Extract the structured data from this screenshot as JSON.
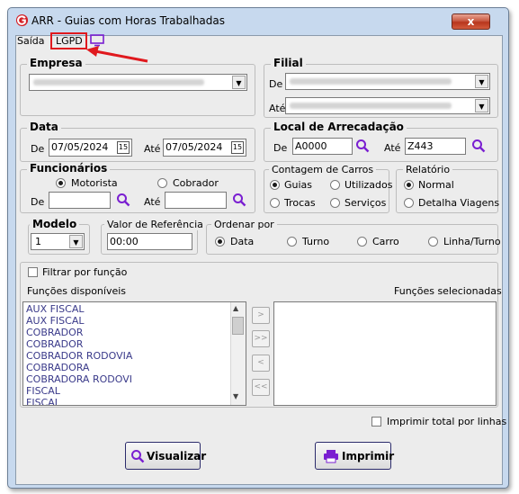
{
  "window": {
    "title": "ARR - Guias com Horas Trabalhadas",
    "close_label": "x"
  },
  "menu": {
    "items": [
      "Saída",
      "LGPD"
    ]
  },
  "empresa": {
    "legend": "Empresa",
    "value": "BR UNICAL DE TRANSPORTES LTDA"
  },
  "filial": {
    "legend": "Filial",
    "de_label": "De",
    "ate_label": "Até",
    "de_value": "BR UNICAL DE TRANSPORTES LTDA",
    "ate_value": "BR UNICAL DE TRANSPORTES LTDA"
  },
  "data": {
    "legend": "Data",
    "de_label": "De",
    "de_value": "07/05/2024",
    "ate_label": "Até",
    "ate_value": "07/05/2024",
    "cal_label": "15"
  },
  "local": {
    "legend": "Local de Arrecadação",
    "de_label": "De",
    "de_value": "A0000",
    "ate_label": "Até",
    "ate_value": "Z443"
  },
  "funcionarios": {
    "legend": "Funcionários",
    "opt1": "Motorista",
    "opt2": "Cobrador",
    "de_label": "De",
    "ate_label": "Até",
    "de_value": "",
    "ate_value": ""
  },
  "contagem": {
    "legend": "Contagem de Carros",
    "opts": [
      "Guias",
      "Utilizados",
      "Trocas",
      "Serviços"
    ]
  },
  "relatorio": {
    "legend": "Relatório",
    "opts": [
      "Normal",
      "Detalha Viagens"
    ]
  },
  "modelo": {
    "legend": "Modelo",
    "value": "1"
  },
  "valor_ref": {
    "legend": "Valor de Referência",
    "value": "00:00"
  },
  "ordenar": {
    "legend": "Ordenar por",
    "opts": [
      "Data",
      "Turno",
      "Carro",
      "Linha/Turno"
    ]
  },
  "funcoes": {
    "filter_label": "Filtrar por função",
    "disp_label": "Funções disponíveis",
    "sel_label": "Funções selecionadas",
    "items": [
      "AUX FISCAL",
      "AUX FISCAL",
      "COBRADOR",
      "COBRADOR",
      "COBRADOR RODOVIA",
      "COBRADORA",
      "COBRADORA RODOVI",
      "FISCAL",
      "FISCAL"
    ],
    "buttons": [
      ">",
      ">>",
      "<",
      "<<"
    ]
  },
  "imprimir_total_label": "Imprimir total por linhas",
  "actions": {
    "visualizar": "Visualizar",
    "imprimir": "Imprimir"
  },
  "colors": {
    "highlight": "#e0191e",
    "accent": "#7a1fd1",
    "title_bg": "#c7d9ee"
  }
}
